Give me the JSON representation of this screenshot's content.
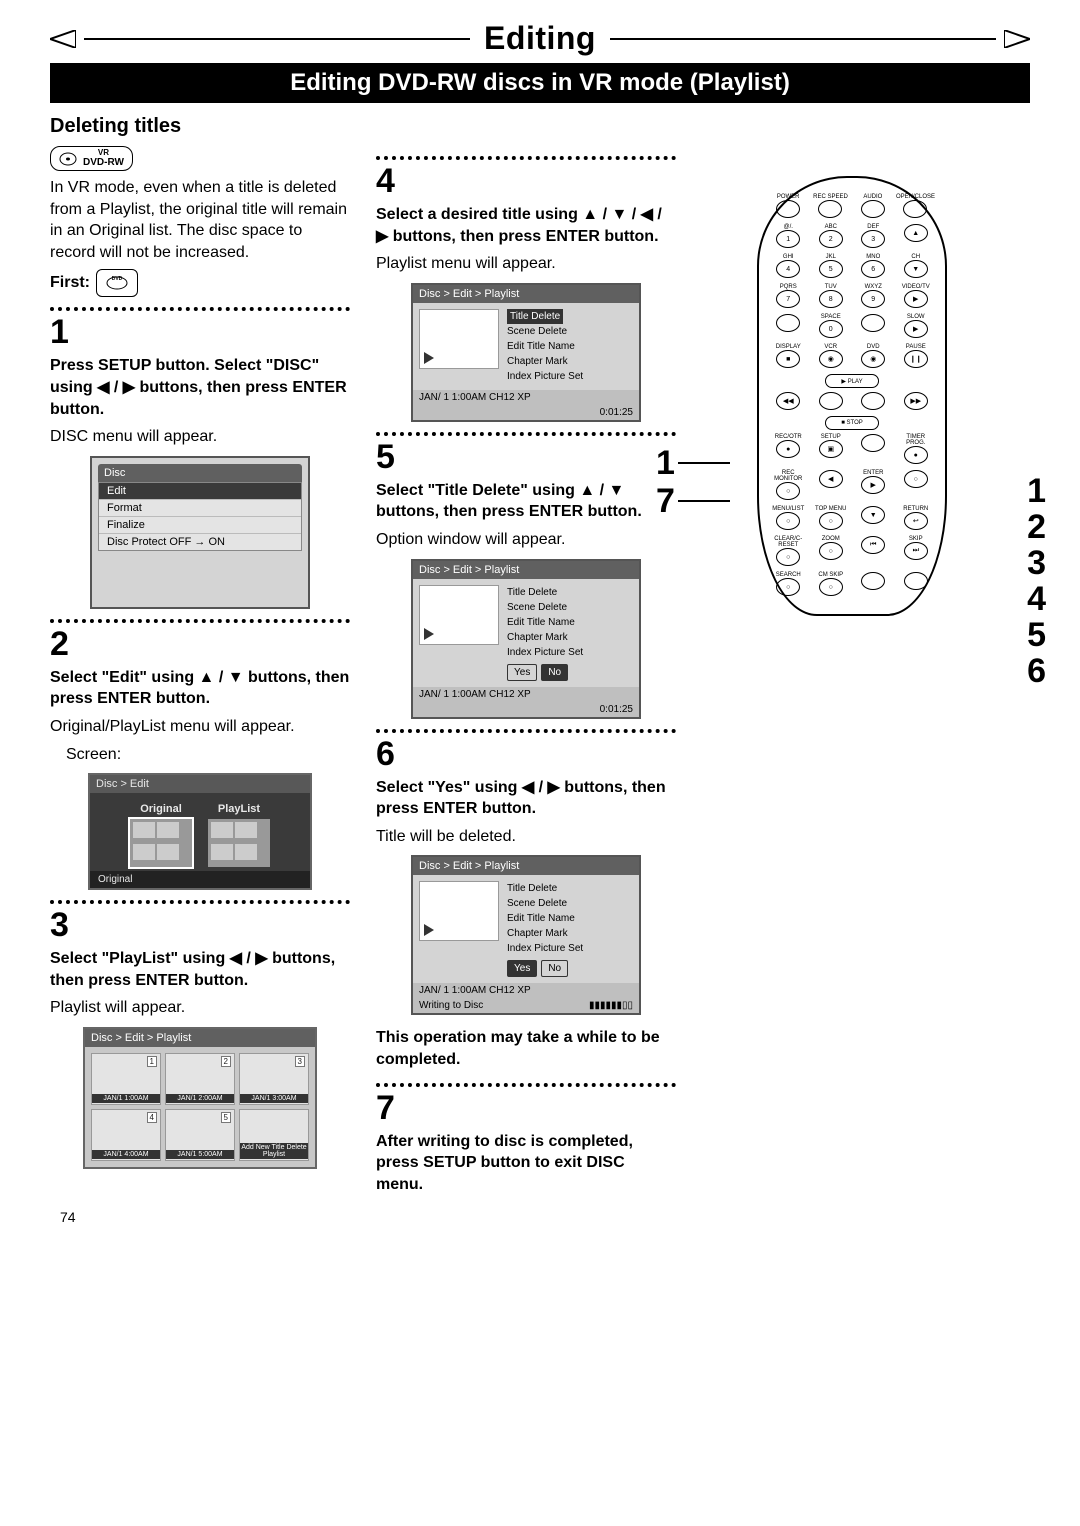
{
  "header": {
    "title": "Editing",
    "banner": "Editing DVD-RW discs in VR mode (Playlist)"
  },
  "section": {
    "heading": "Deleting titles",
    "badge_vr": "VR",
    "badge_dvd_rw": "DVD-RW",
    "intro": "In VR mode, even when a title is deleted from a Playlist, the original title will remain in an Original list. The disc space to record will not be increased.",
    "first": "First:",
    "first_icon_text": "DVD"
  },
  "steps": {
    "1": {
      "num": "1",
      "title": "Press SETUP button. Select \"DISC\" using ◀ / ▶ buttons, then press ENTER button.",
      "after": "DISC menu will appear."
    },
    "2": {
      "num": "2",
      "title": "Select \"Edit\" using ▲ / ▼ buttons, then press ENTER button.",
      "after": "Original/PlayList menu will appear.",
      "screen_label": "Screen:"
    },
    "3": {
      "num": "3",
      "title": "Select \"PlayList\" using ◀ / ▶ buttons, then press ENTER button.",
      "after": "Playlist will appear."
    },
    "4": {
      "num": "4",
      "title": "Select a desired title using ▲ / ▼ / ◀ / ▶ buttons, then press ENTER button.",
      "after": "Playlist menu will appear."
    },
    "5": {
      "num": "5",
      "title": "Select \"Title Delete\" using ▲ / ▼ buttons, then press ENTER button.",
      "after": "Option window will appear."
    },
    "6": {
      "num": "6",
      "title": "Select \"Yes\" using ◀ / ▶ buttons, then press ENTER button.",
      "after": "Title will be deleted."
    },
    "7": {
      "num": "7",
      "title": "After writing to disc is completed, press SETUP button to exit DISC menu."
    }
  },
  "warning": "This operation may take a while to be completed.",
  "osd": {
    "disc": {
      "header": "Disc",
      "items": [
        "Edit",
        "Format",
        "Finalize",
        "Disc Protect OFF → ON"
      ]
    },
    "edit": {
      "header": "Disc > Edit",
      "tab1": "Original",
      "tab2": "PlayList",
      "footer": "Original"
    },
    "playlist_grid": {
      "header": "Disc > Edit > Playlist",
      "cells": [
        {
          "num": "1",
          "label": "JAN/1  1:00AM"
        },
        {
          "num": "2",
          "label": "JAN/1  2:00AM"
        },
        {
          "num": "3",
          "label": "JAN/1  3:00AM"
        },
        {
          "num": "4",
          "label": "JAN/1  4:00AM"
        },
        {
          "num": "5",
          "label": "JAN/1  5:00AM"
        },
        {
          "num": "",
          "label": "Add New Title Delete Playlist"
        }
      ]
    },
    "playlist_menu": {
      "header": "Disc > Edit > Playlist",
      "items": [
        "Title Delete",
        "Scene Delete",
        "Edit Title Name",
        "Chapter Mark",
        "Index Picture Set"
      ],
      "footer_left": "JAN/ 1   1:00AM  CH12    XP",
      "footer_right": "0:01:25"
    },
    "yes_no": {
      "yes": "Yes",
      "no": "No"
    },
    "writing": "Writing to Disc"
  },
  "remote": {
    "row1": [
      "POWER",
      "REC SPEED",
      "AUDIO",
      "OPEN/CLOSE"
    ],
    "row2_top": [
      "@/.",
      "ABC",
      "DEF",
      ""
    ],
    "row2": [
      "1",
      "2",
      "3",
      "▲"
    ],
    "row3_top": [
      "GHI",
      "JKL",
      "MNO",
      "CH"
    ],
    "row3": [
      "4",
      "5",
      "6",
      "▼"
    ],
    "row4_top": [
      "PQRS",
      "TUV",
      "WXYZ",
      "VIDEO/TV"
    ],
    "row4": [
      "7",
      "8",
      "9",
      "▶"
    ],
    "row5_top": [
      "",
      "SPACE",
      "",
      "SLOW"
    ],
    "row5": [
      "",
      "0",
      "",
      "▶"
    ],
    "row6_top": [
      "DISPLAY",
      "VCR",
      "DVD",
      "PAUSE"
    ],
    "row6": [
      "■",
      "◉",
      "◉",
      "❙❙"
    ],
    "play": "PLAY",
    "stop": "STOP",
    "row7_top": [
      "REC/OTR",
      "SETUP",
      "",
      "TIMER PROG."
    ],
    "row8_top": [
      "REC MONITOR",
      "",
      "ENTER",
      ""
    ],
    "row9_top": [
      "MENU/LIST",
      "TOP MENU",
      "",
      "RETURN"
    ],
    "row10_top": [
      "CLEAR/C-RESET",
      "ZOOM",
      "",
      "SKIP"
    ],
    "row11_top": [
      "SEARCH",
      "CM SKIP",
      "",
      ""
    ]
  },
  "callouts_left": {
    "one": "1",
    "seven": "7"
  },
  "callouts_right": {
    "r1": "1",
    "r2": "2",
    "r3": "3",
    "r4": "4",
    "r5": "5",
    "r6": "6"
  },
  "page_number": "74"
}
